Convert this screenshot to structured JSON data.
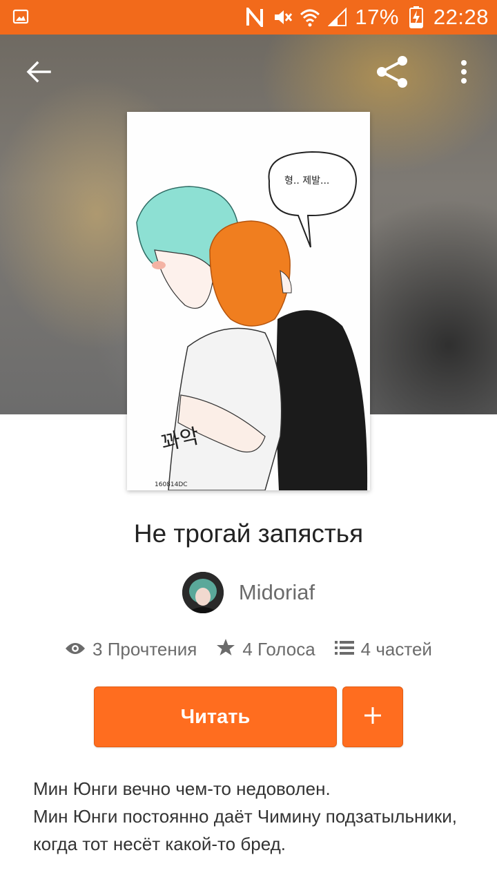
{
  "status_bar": {
    "battery": "17%",
    "time": "22:28"
  },
  "story": {
    "title": "Не трогай запястья",
    "author": "Midoriaf",
    "stats": {
      "reads": "3 Прочтения",
      "votes": "4 Голоса",
      "parts": "4 частей"
    },
    "read_button": "Читать",
    "add_button": "+",
    "description": [
      "Мин Юнги вечно чем-то недоволен.",
      "Мин Юнги постоянно даёт Чимину подзатыльники, когда тот несёт какой-то бред."
    ]
  },
  "cover_art": {
    "speech_bubble": "형.. 제발...",
    "sound_text": "꽈악",
    "signature": "160814DC"
  },
  "colors": {
    "accent": "#ff6d1f",
    "status_bar": "#f26a1b"
  },
  "icons": [
    "image-icon",
    "nfc-icon",
    "mute-icon",
    "wifi-icon",
    "signal-icon",
    "battery-charging-icon",
    "back-arrow-icon",
    "share-icon",
    "more-vertical-icon",
    "eye-icon",
    "star-icon",
    "list-icon",
    "plus-icon"
  ]
}
